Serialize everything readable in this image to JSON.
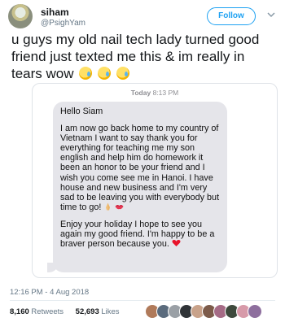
{
  "user": {
    "name": "siham",
    "handle": "@PsighYam",
    "follow_label": "Follow"
  },
  "tweet": {
    "text": "u guys my old nail tech lady turned good friend just texted me this & im really in tears wow",
    "emojis": [
      "crying-face-emoji",
      "crying-face-emoji",
      "crying-face-emoji"
    ]
  },
  "screenshot": {
    "timestamp_day": "Today",
    "timestamp_time": "8:13 PM",
    "message": {
      "greeting": "Hello Siam",
      "paragraph1": "I am now go back home to my country of Vietnam I want to say thank you for everything for teaching me my son english and help him do homework it been an honor to be your friend and I wish you come see me in Hanoi. I have house and new business and I'm very sad to be leaving you with everybody but time to go!",
      "paragraph2": "Enjoy your holiday I hope to see you again my good friend. I'm happy to be a braver person because you.",
      "paragraph1_emojis": [
        "folded-hands-emoji",
        "kiss-mark-emoji"
      ],
      "paragraph2_emoji": "red-heart-emoji"
    }
  },
  "meta": {
    "datetime": "12:16 PM - 4 Aug 2018",
    "retweets_count": "8,160",
    "retweets_label": "Retweets",
    "likes_count": "52,693",
    "likes_label": "Likes"
  },
  "colors": {
    "accent": "#1da1f2",
    "heart": "#e0245e",
    "bubble": "#e5e5ea"
  }
}
